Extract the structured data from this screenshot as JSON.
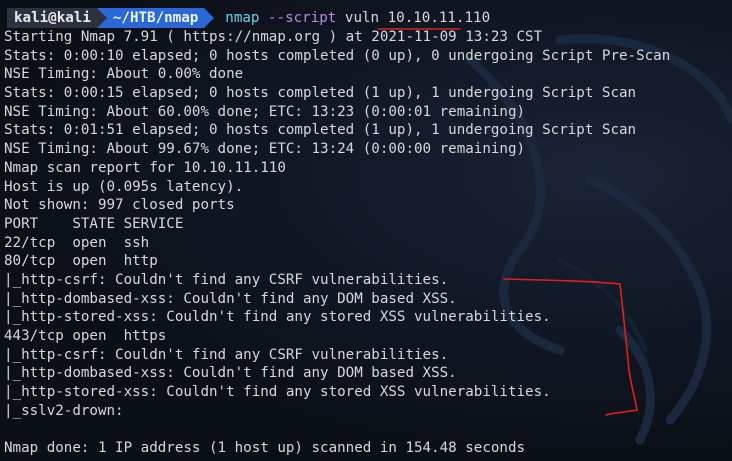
{
  "prompt": {
    "user": "kali@kali",
    "path": "~/HTB/nmap",
    "command": "nmap",
    "flag": "--script",
    "args": " vuln 10.10.11.110"
  },
  "output": [
    "Starting Nmap 7.91 ( https://nmap.org ) at 2021-11-09 13:23 CST",
    "Stats: 0:00:10 elapsed; 0 hosts completed (0 up), 0 undergoing Script Pre-Scan",
    "NSE Timing: About 0.00% done",
    "Stats: 0:00:15 elapsed; 0 hosts completed (1 up), 1 undergoing Script Scan",
    "NSE Timing: About 60.00% done; ETC: 13:23 (0:00:01 remaining)",
    "Stats: 0:01:51 elapsed; 0 hosts completed (1 up), 1 undergoing Script Scan",
    "NSE Timing: About 99.67% done; ETC: 13:24 (0:00:00 remaining)",
    "Nmap scan report for 10.10.11.110",
    "Host is up (0.095s latency).",
    "Not shown: 997 closed ports",
    "PORT    STATE SERVICE",
    "22/tcp  open  ssh",
    "80/tcp  open  http",
    "|_http-csrf: Couldn't find any CSRF vulnerabilities.",
    "|_http-dombased-xss: Couldn't find any DOM based XSS.",
    "|_http-stored-xss: Couldn't find any stored XSS vulnerabilities.",
    "443/tcp open  https",
    "|_http-csrf: Couldn't find any CSRF vulnerabilities.",
    "|_http-dombased-xss: Couldn't find any DOM based XSS.",
    "|_http-stored-xss: Couldn't find any stored XSS vulnerabilities.",
    "|_sslv2-drown:",
    "",
    "Nmap done: 1 IP address (1 host up) scanned in 154.48 seconds"
  ],
  "colors": {
    "background": "#0b0f16",
    "text": "#d6d8dc",
    "prompt_user_bg": "#2c3140",
    "prompt_path_bg": "#2a68d8",
    "command": "#67d2e8",
    "flag": "#b98ae0",
    "annotation": "#e0201c"
  }
}
